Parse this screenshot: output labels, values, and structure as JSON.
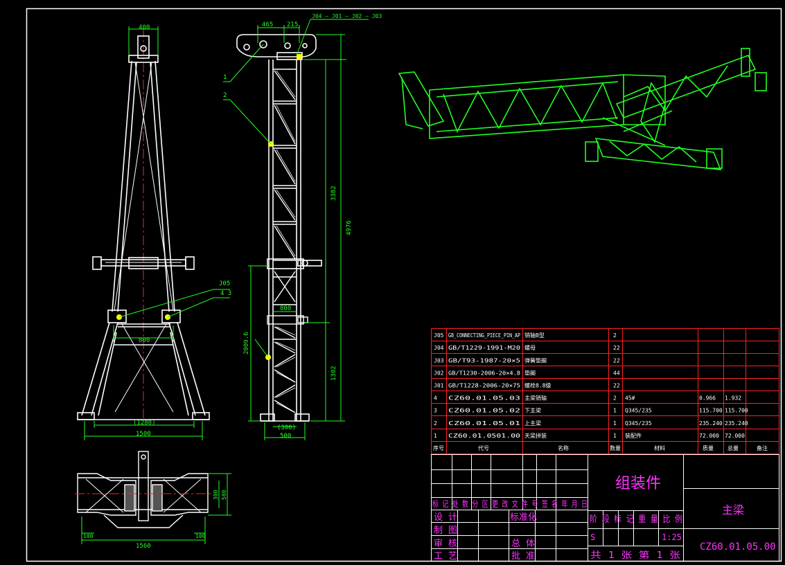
{
  "colors": {
    "background": "#000000",
    "frame": "#ffffff",
    "structure": "#ffffff",
    "dimension": "#22ff22",
    "centerline": "#ff2222",
    "title_text": "#ff33ff",
    "table_line": "#ff2222",
    "model3d": "#22ff22",
    "marker": "#ffff00"
  },
  "front_view": {
    "dims": {
      "top_width": "400",
      "mid_width": "800",
      "base_inner": "(1280)",
      "base_outer": "1500"
    },
    "callouts": {
      "j05": "J05",
      "items": "4 3"
    }
  },
  "side_view": {
    "dims": {
      "top_a": "465",
      "top_b": "215",
      "height_upper": "3382",
      "height_total": "4976",
      "height_lower_a": "2009.6",
      "height_lower_b": "1302",
      "clip_width": "800",
      "base_inner": "(300)",
      "base_outer": "500"
    },
    "callouts": {
      "top_chain": "J04 — J01 — J02 — J03",
      "item1": "1",
      "item2": "2"
    }
  },
  "bottom_view": {
    "dims": {
      "h1": "300",
      "h2": "580",
      "left_off": "100",
      "right_off": "100",
      "width": "1560"
    }
  },
  "parts": [
    {
      "no": "J05",
      "code": "GB_CONNECTING_PIECE_PIN_AP",
      "name": "销轴B型",
      "qty": "2",
      "material": "",
      "unit_w": "",
      "total_w": "",
      "note": ""
    },
    {
      "no": "J04",
      "code": "GB/T1229-1991-M20",
      "name": "螺母",
      "qty": "22",
      "material": "",
      "unit_w": "",
      "total_w": "",
      "note": ""
    },
    {
      "no": "J03",
      "code": "GB/T93-1987-20×5",
      "name": "弹簧垫圈",
      "qty": "22",
      "material": "",
      "unit_w": "",
      "total_w": "",
      "note": ""
    },
    {
      "no": "J02",
      "code": "GB/T1230-2006-20×4.8",
      "name": "垫圈",
      "qty": "44",
      "material": "",
      "unit_w": "",
      "total_w": "",
      "note": ""
    },
    {
      "no": "J01",
      "code": "GB/T1228-2006-20×75",
      "name": "螺栓8.8级",
      "qty": "22",
      "material": "",
      "unit_w": "",
      "total_w": "",
      "note": ""
    },
    {
      "no": "4",
      "code": "CZ60.01.05.03",
      "name": "主梁销轴",
      "qty": "2",
      "material": "45#",
      "unit_w": "0.966",
      "total_w": "1.932",
      "note": ""
    },
    {
      "no": "3",
      "code": "CZ60.01.05.02",
      "name": "下主梁",
      "qty": "1",
      "material": "Q345/235",
      "unit_w": "115.700",
      "total_w": "115.700",
      "note": ""
    },
    {
      "no": "2",
      "code": "CZ60.01.05.01",
      "name": "上主梁",
      "qty": "1",
      "material": "Q345/235",
      "unit_w": "235.240",
      "total_w": "235.240",
      "note": ""
    },
    {
      "no": "1",
      "code": "CZ60.01.0501.00",
      "name": "天梁拼装",
      "qty": "1",
      "material": "装配件",
      "unit_w": "72.000",
      "total_w": "72.000",
      "note": ""
    }
  ],
  "parts_header": {
    "no": "序号",
    "code": "代号",
    "name": "名称",
    "qty": "数量",
    "material": "材料",
    "unit_w": "质量",
    "total_w": "总量",
    "note": "备注"
  },
  "title_block": {
    "assembly_type": "组装件",
    "part_name": "主梁",
    "drawing_no": "CZ60.01.05.00",
    "revision_row": "标 记 处 数 分 区 更 改 文 件 号 签 名 年 月 日",
    "roles": [
      "设 计",
      "制 图",
      "审 核",
      "工 艺"
    ],
    "standardize": "标准化",
    "overall": "总 体",
    "approve": "批 准",
    "stage_row": "阶 段 标 记 重 量 比 例",
    "stage": "S",
    "scale": "1:25",
    "sheets": "共  1  张  第  1  张"
  }
}
